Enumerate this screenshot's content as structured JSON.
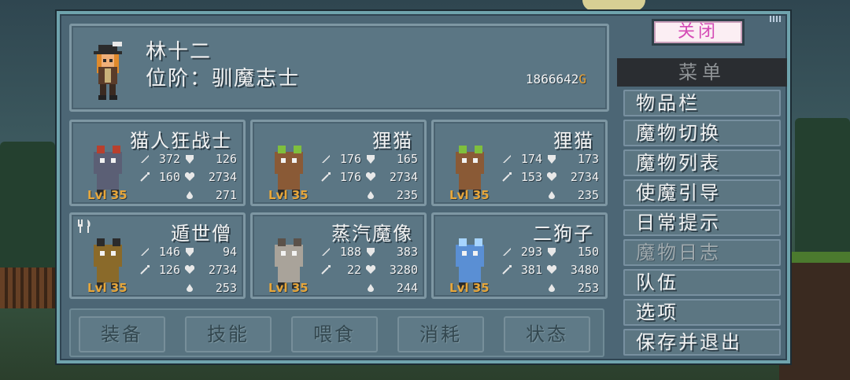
{
  "player": {
    "name": "林十二",
    "rank": "位阶：驯魔志士",
    "gold": "1866642",
    "gold_unit": "G"
  },
  "monsters": [
    {
      "name": "猫人狂战士",
      "level": "Lvl 35",
      "atk": "372",
      "def": "126",
      "mag": "160",
      "hp": "2734",
      "mp": "271",
      "sprite": "cat-warrior"
    },
    {
      "name": "狸猫",
      "level": "Lvl 35",
      "atk": "176",
      "def": "165",
      "mag": "176",
      "hp": "2734",
      "mp": "235",
      "sprite": "tanuki"
    },
    {
      "name": "狸猫",
      "level": "Lvl 35",
      "atk": "174",
      "def": "173",
      "mag": "153",
      "hp": "2734",
      "mp": "235",
      "sprite": "tanuki"
    },
    {
      "name": "遁世僧",
      "level": "Lvl 35",
      "atk": "146",
      "def": "94",
      "mag": "126",
      "hp": "2734",
      "mp": "253",
      "sprite": "hermit-monk"
    },
    {
      "name": "蒸汽魔像",
      "level": "Lvl 35",
      "atk": "188",
      "def": "383",
      "mag": "22",
      "hp": "3280",
      "mp": "244",
      "sprite": "steam-golem"
    },
    {
      "name": "二狗子",
      "level": "Lvl 35",
      "atk": "293",
      "def": "150",
      "mag": "381",
      "hp": "3480",
      "mp": "253",
      "sprite": "blue-wolf"
    }
  ],
  "tabs": [
    "装备",
    "技能",
    "喂食",
    "消耗",
    "状态"
  ],
  "close_label": "关闭",
  "menu": {
    "header": "菜单",
    "items": [
      {
        "label": "物品栏",
        "enabled": true
      },
      {
        "label": "魔物切换",
        "enabled": true
      },
      {
        "label": "魔物列表",
        "enabled": true
      },
      {
        "label": "使魔引导",
        "enabled": true
      },
      {
        "label": "日常提示",
        "enabled": true
      },
      {
        "label": "魔物日志",
        "enabled": false
      },
      {
        "label": "队伍",
        "enabled": true
      },
      {
        "label": "选项",
        "enabled": true
      },
      {
        "label": "保存并退出",
        "enabled": true
      }
    ]
  },
  "icons": {
    "attack": "sword-icon",
    "defense": "shield-icon",
    "magic": "wand-icon",
    "health": "heart-icon",
    "mana": "mana-drop-icon",
    "sort": "fork-knife-icon"
  },
  "colors": {
    "level": "#e8a73a",
    "gold_unit": "#f0a636",
    "close": "#d44ab5"
  }
}
